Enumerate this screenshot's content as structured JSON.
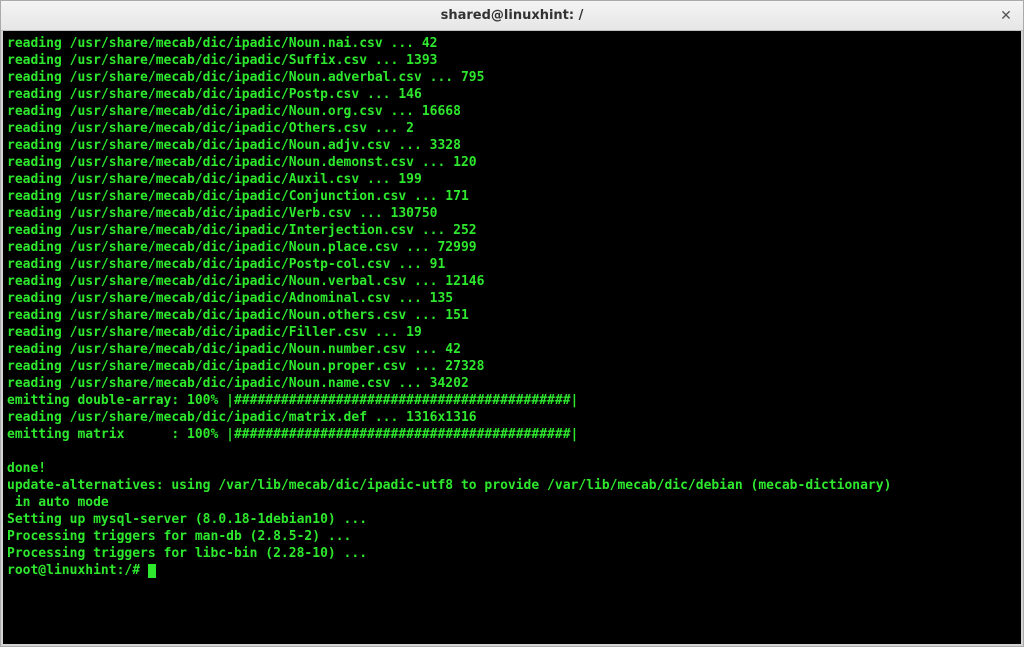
{
  "window": {
    "title": "shared@linuxhint: /",
    "close_icon": "✕"
  },
  "terminal": {
    "lines": [
      "reading /usr/share/mecab/dic/ipadic/Noun.nai.csv ... 42",
      "reading /usr/share/mecab/dic/ipadic/Suffix.csv ... 1393",
      "reading /usr/share/mecab/dic/ipadic/Noun.adverbal.csv ... 795",
      "reading /usr/share/mecab/dic/ipadic/Postp.csv ... 146",
      "reading /usr/share/mecab/dic/ipadic/Noun.org.csv ... 16668",
      "reading /usr/share/mecab/dic/ipadic/Others.csv ... 2",
      "reading /usr/share/mecab/dic/ipadic/Noun.adjv.csv ... 3328",
      "reading /usr/share/mecab/dic/ipadic/Noun.demonst.csv ... 120",
      "reading /usr/share/mecab/dic/ipadic/Auxil.csv ... 199",
      "reading /usr/share/mecab/dic/ipadic/Conjunction.csv ... 171",
      "reading /usr/share/mecab/dic/ipadic/Verb.csv ... 130750",
      "reading /usr/share/mecab/dic/ipadic/Interjection.csv ... 252",
      "reading /usr/share/mecab/dic/ipadic/Noun.place.csv ... 72999",
      "reading /usr/share/mecab/dic/ipadic/Postp-col.csv ... 91",
      "reading /usr/share/mecab/dic/ipadic/Noun.verbal.csv ... 12146",
      "reading /usr/share/mecab/dic/ipadic/Adnominal.csv ... 135",
      "reading /usr/share/mecab/dic/ipadic/Noun.others.csv ... 151",
      "reading /usr/share/mecab/dic/ipadic/Filler.csv ... 19",
      "reading /usr/share/mecab/dic/ipadic/Noun.number.csv ... 42",
      "reading /usr/share/mecab/dic/ipadic/Noun.proper.csv ... 27328",
      "reading /usr/share/mecab/dic/ipadic/Noun.name.csv ... 34202",
      "emitting double-array: 100% |###########################################|",
      "reading /usr/share/mecab/dic/ipadic/matrix.def ... 1316x1316",
      "emitting matrix      : 100% |###########################################|",
      "",
      "done!",
      "update-alternatives: using /var/lib/mecab/dic/ipadic-utf8 to provide /var/lib/mecab/dic/debian (mecab-dictionary)",
      " in auto mode",
      "Setting up mysql-server (8.0.18-1debian10) ...",
      "Processing triggers for man-db (2.8.5-2) ...",
      "Processing triggers for libc-bin (2.28-10) ..."
    ],
    "prompt": "root@linuxhint:/#"
  }
}
